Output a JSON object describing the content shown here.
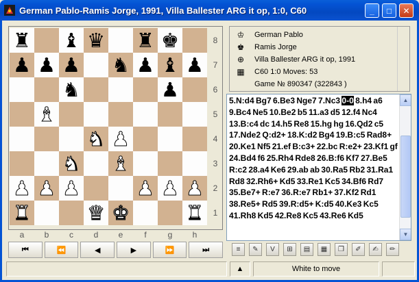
{
  "window": {
    "title": "German Pablo-Ramis Jorge, 1991, Villa Ballester ARG it op, 1:0, C60",
    "min_label": "_",
    "max_label": "□",
    "close_label": "✕"
  },
  "board": {
    "ranks": [
      "8",
      "7",
      "6",
      "5",
      "4",
      "3",
      "2",
      "1"
    ],
    "files": [
      "a",
      "b",
      "c",
      "d",
      "e",
      "f",
      "g",
      "h"
    ],
    "position": [
      [
        "bR",
        "",
        "bB",
        "bQ",
        "",
        "bR",
        "bK",
        ""
      ],
      [
        "bP",
        "bP",
        "bP",
        "",
        "bN",
        "bP",
        "bB",
        "bP"
      ],
      [
        "",
        "",
        "bN",
        "",
        "",
        "",
        "bP",
        ""
      ],
      [
        "",
        "wB",
        "",
        "",
        "",
        "",
        "",
        ""
      ],
      [
        "",
        "",
        "",
        "wN",
        "wP",
        "",
        "",
        ""
      ],
      [
        "",
        "",
        "wN",
        "",
        "wB",
        "",
        "",
        ""
      ],
      [
        "wP",
        "wP",
        "wP",
        "",
        "",
        "wP",
        "wP",
        "wP"
      ],
      [
        "wR",
        "",
        "",
        "wQ",
        "wK",
        "",
        "",
        "wR"
      ]
    ]
  },
  "nav": {
    "first": "⏮",
    "back_fast": "⏪",
    "back": "◀",
    "forward": "▶",
    "forward_fast": "⏩",
    "last": "⏭"
  },
  "info": {
    "white": "German Pablo",
    "black": "Ramis Jorge",
    "event": "Villa Ballester ARG it op, 1991",
    "eco_line": "C60  1:0  Moves: 53",
    "game_no": "Game № 890347 (322843 )"
  },
  "moves": {
    "before_highlight": "5.N:d4 Bg7 6.Be3 Nge7 7.Nc3 ",
    "highlight": "0-0",
    "after_highlight": " 8.h4 a6 9.Bc4 Ne5 10.Be2 b5 11.a3 d5 12.f4 Nc4 13.B:c4 dc 14.h5 Re8 15.hg hg 16.Qd2 c5 17.Nde2 Q:d2+ 18.K:d2 Bg4 19.B:c5 Rad8+ 20.Ke1 Nf5 21.ef B:c3+ 22.bc R:e2+ 23.Kf1 gf 24.Bd4 f6 25.Rh4 Rde8 26.B:f6 Kf7 27.Be5 R:c2 28.a4 Ke6 29.ab ab 30.Ra5 Rb2 31.Ra1 Rd8 32.Rh6+ Kd5 33.Re1 Kc5 34.Bf6 Rd7 35.Be7+ R:e7 36.R:e7 Rb1+ 37.Kf2 Rd1 38.Re5+ Rd5 39.R:d5+ K:d5 40.Ke3 Kc5 41.Rh8 Kd5 42.Re8 Kc5 43.Re6 Kd5"
  },
  "status": {
    "left": "",
    "arrow": "▲",
    "turn": "White to move",
    "right": ""
  },
  "colors": {
    "light_square": "#fdfdfd",
    "dark_square": "#d2b291",
    "titlebar": "#0453d4"
  }
}
